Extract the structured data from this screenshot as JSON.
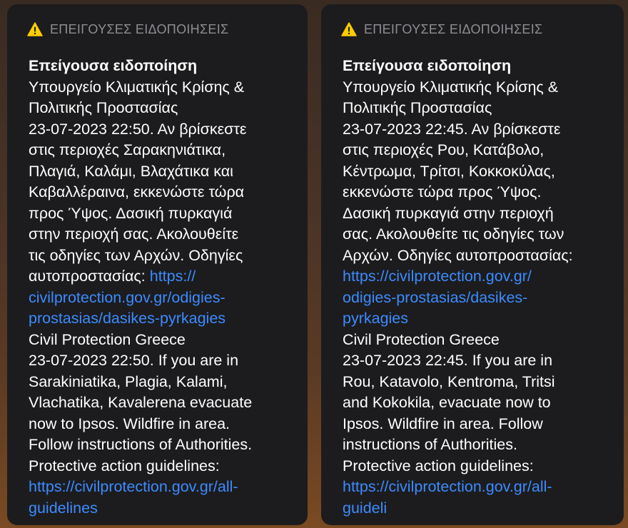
{
  "alerts": [
    {
      "header": "ΕΠΕΙΓΟΥΣΕΣ ΕΙΔΟΠΟΙΗΣΕΙΣ",
      "title": "Επείγουσα ειδοποίηση",
      "greek_text": "Υπουργείο Κλιματικής Κρίσης &\nΠολιτικής Προστασίας\n23-07-2023 22:50. Αν βρίσκεστε\nστις περιοχές Σαρακηνιάτικα,\nΠλαγιά, Καλάμι, Βλαχάτικα και\nΚαβαλλέραινα, εκκενώστε τώρα\nπρος Ύψος. Δασική πυρκαγιά\nστην περιοχή σας. Ακολουθείτε\nτις οδηγίες των Αρχών. Οδηγίες\nαυτοπροστασίας: ",
      "greek_link": "https://\ncivilprotection.gov.gr/odigies-\nprostasias/dasikes-pyrkagies",
      "english_text": "\nCivil Protection Greece\n23-07-2023 22:50. If you are in\nSarakiniatika, Plagia, Kalami,\nVlachatika, Kavalerena evacuate\nnow to Ipsos. Wildfire in area.\nFollow instructions of Authorities.\nProtective action guidelines:\n",
      "english_link": "https://civilprotection.gov.gr/all-\nguidelines"
    },
    {
      "header": "ΕΠΕΙΓΟΥΣΕΣ ΕΙΔΟΠΟΙΗΣΕΙΣ",
      "title": "Επείγουσα ειδοποίηση",
      "greek_text": "Υπουργείο Κλιματικής Κρίσης &\nΠολιτικής Προστασίας\n23-07-2023 22:45. Αν βρίσκεστε\nστις περιοχές Ρου, Κατάβολο,\nΚέντρωμα, Τρίτσι, Κοκκοκύλας,\nεκκενώστε τώρα προς Ύψος.\nΔασική πυρκαγιά στην περιοχή\nσας. Ακολουθείτε τις οδηγίες των\nΑρχών. Οδηγίες αυτοπροστασίας:\n",
      "greek_link": "https://civilprotection.gov.gr/\nodigies-prostasias/dasikes-\npyrkagies",
      "english_text": "\nCivil Protection Greece\n23-07-2023 22:45. If you are in\nRou, Katavolo, Kentroma, Tritsi\nand Kokokila, evacuate now to\nIpsos. Wildfire in area. Follow\ninstructions of Authorities.\nProtective action guidelines:\n",
      "english_link": "https://civilprotection.gov.gr/all-\nguideli"
    }
  ],
  "colors": {
    "card_bg": "#1c1c1e",
    "header_text": "#8e8e93",
    "link": "#3d8bff",
    "warning_icon": "#ffcc00"
  },
  "icons": {
    "header_icon": "warning-triangle-icon"
  }
}
